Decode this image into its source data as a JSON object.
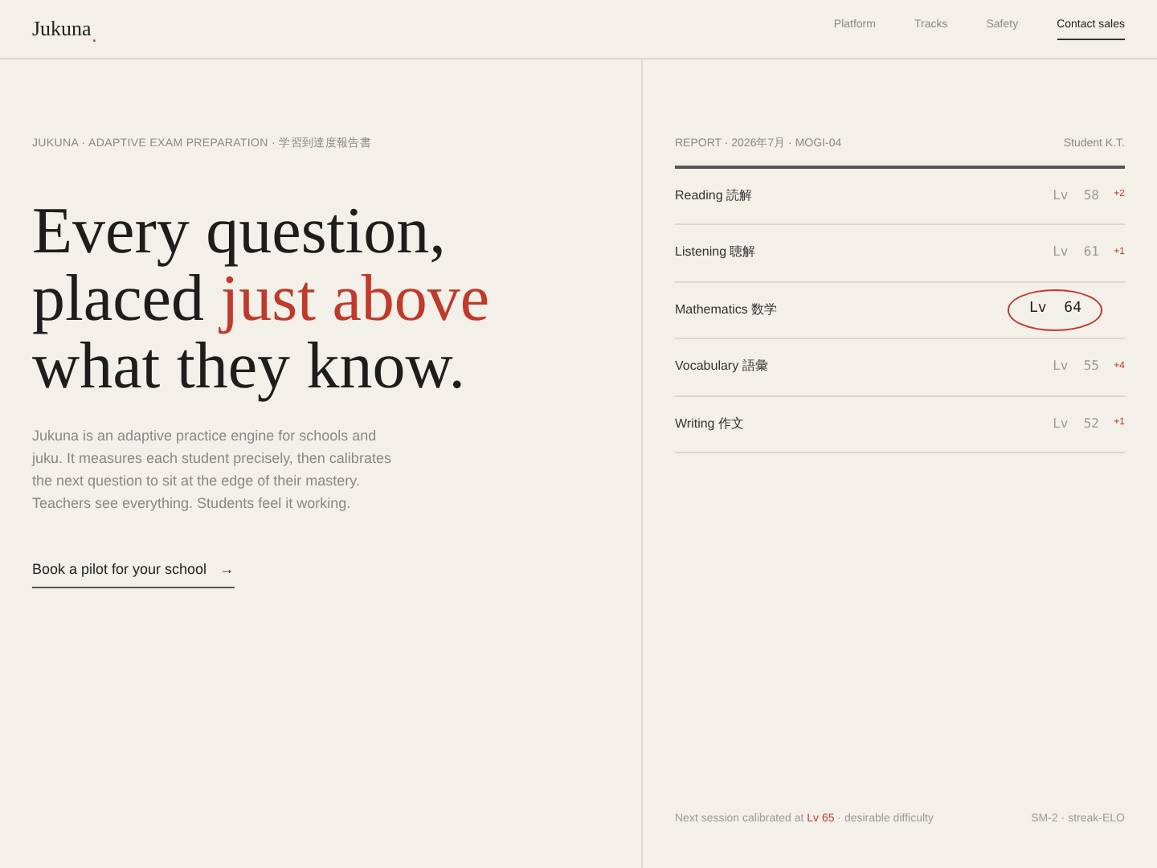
{
  "brand": {
    "name": "Jukuna",
    "mark": "."
  },
  "nav": [
    {
      "label": "Platform",
      "selected": false
    },
    {
      "label": "Tracks",
      "selected": false
    },
    {
      "label": "Safety",
      "selected": false
    },
    {
      "label": "Contact sales",
      "selected": true
    }
  ],
  "hero": {
    "eyebrow": "JUKUNA · ADAPTIVE EXAM PREPARATION · 学習到達度報告書",
    "headline": [
      "Every question,",
      "placed ",
      "just above",
      "what they know."
    ],
    "body": "Jukuna is an adaptive practice engine for schools and juku. It measures each student precisely, then calibrates the next question to sit at the edge of their mastery. Teachers see everything. Students feel it working.",
    "cta": "Book a pilot for your school",
    "cta_arrow": "→"
  },
  "report": {
    "title": "REPORT · 2026年7月 · MOGI-04",
    "student": "Student K.T.",
    "rows": [
      {
        "subject": "Reading 読解",
        "level": "Lv  58",
        "delta": "+2",
        "circled": false
      },
      {
        "subject": "Listening 聴解",
        "level": "Lv  61",
        "delta": "+1",
        "circled": false
      },
      {
        "subject": "Mathematics 数学",
        "level": "Lv  64",
        "circled": true
      },
      {
        "subject": "Vocabulary 語彙",
        "level": "Lv  55",
        "delta": "+4",
        "circled": false
      },
      {
        "subject": "Writing 作文",
        "level": "Lv  52",
        "delta": "+1",
        "circled": false
      }
    ],
    "footer": {
      "before": "Next session calibrated at ",
      "highlight": "Lv 65",
      "after": " · desirable difficulty",
      "method": "SM-2 · streak-ELO"
    }
  }
}
